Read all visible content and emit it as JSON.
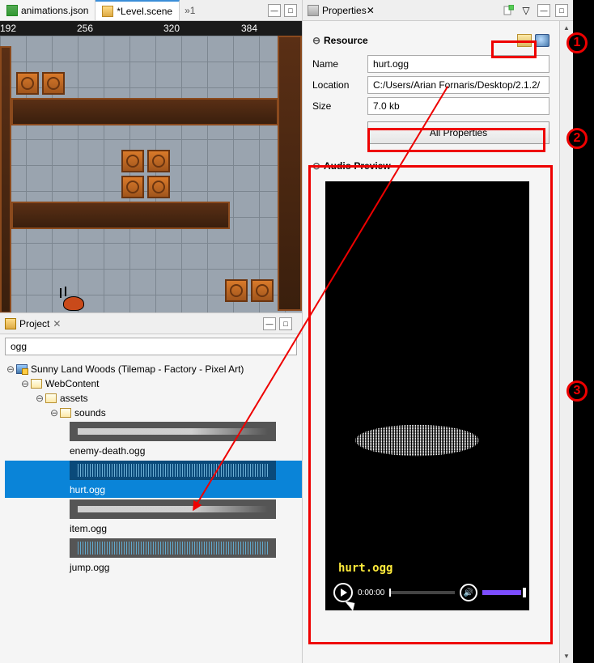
{
  "tabs": {
    "left": [
      {
        "label": "animations.json",
        "icon": "json",
        "active": false
      },
      {
        "label": "*Level.scene",
        "icon": "scene",
        "active": true
      }
    ],
    "more_indicator": "»1",
    "properties_tab": "Properties"
  },
  "ruler": {
    "marks": [
      "192",
      "256",
      "320",
      "384"
    ]
  },
  "project_panel": {
    "title": "Project",
    "filter_value": "ogg",
    "tree": {
      "root": "Sunny Land Woods (Tilemap - Factory - Pixel Art)",
      "webcontent": "WebContent",
      "assets": "assets",
      "sounds": "sounds",
      "items": [
        {
          "label": "enemy-death.ogg",
          "selected": false
        },
        {
          "label": "hurt.ogg",
          "selected": true
        },
        {
          "label": "item.ogg",
          "selected": false
        },
        {
          "label": "jump.ogg",
          "selected": false
        }
      ]
    }
  },
  "properties": {
    "resource_section": "Resource",
    "fields": {
      "name_label": "Name",
      "name_value": "hurt.ogg",
      "location_label": "Location",
      "location_value": "C:/Users/Arian Fornaris/Desktop/2.1.2/",
      "size_label": "Size",
      "size_value": "7.0 kb"
    },
    "all_properties_btn": "All Properties",
    "audio_preview_section": "Audio Preview",
    "audio": {
      "filename": "hurt.ogg",
      "time": "0:00:00"
    }
  },
  "callouts": {
    "c1": "1",
    "c2": "2",
    "c3": "3"
  }
}
